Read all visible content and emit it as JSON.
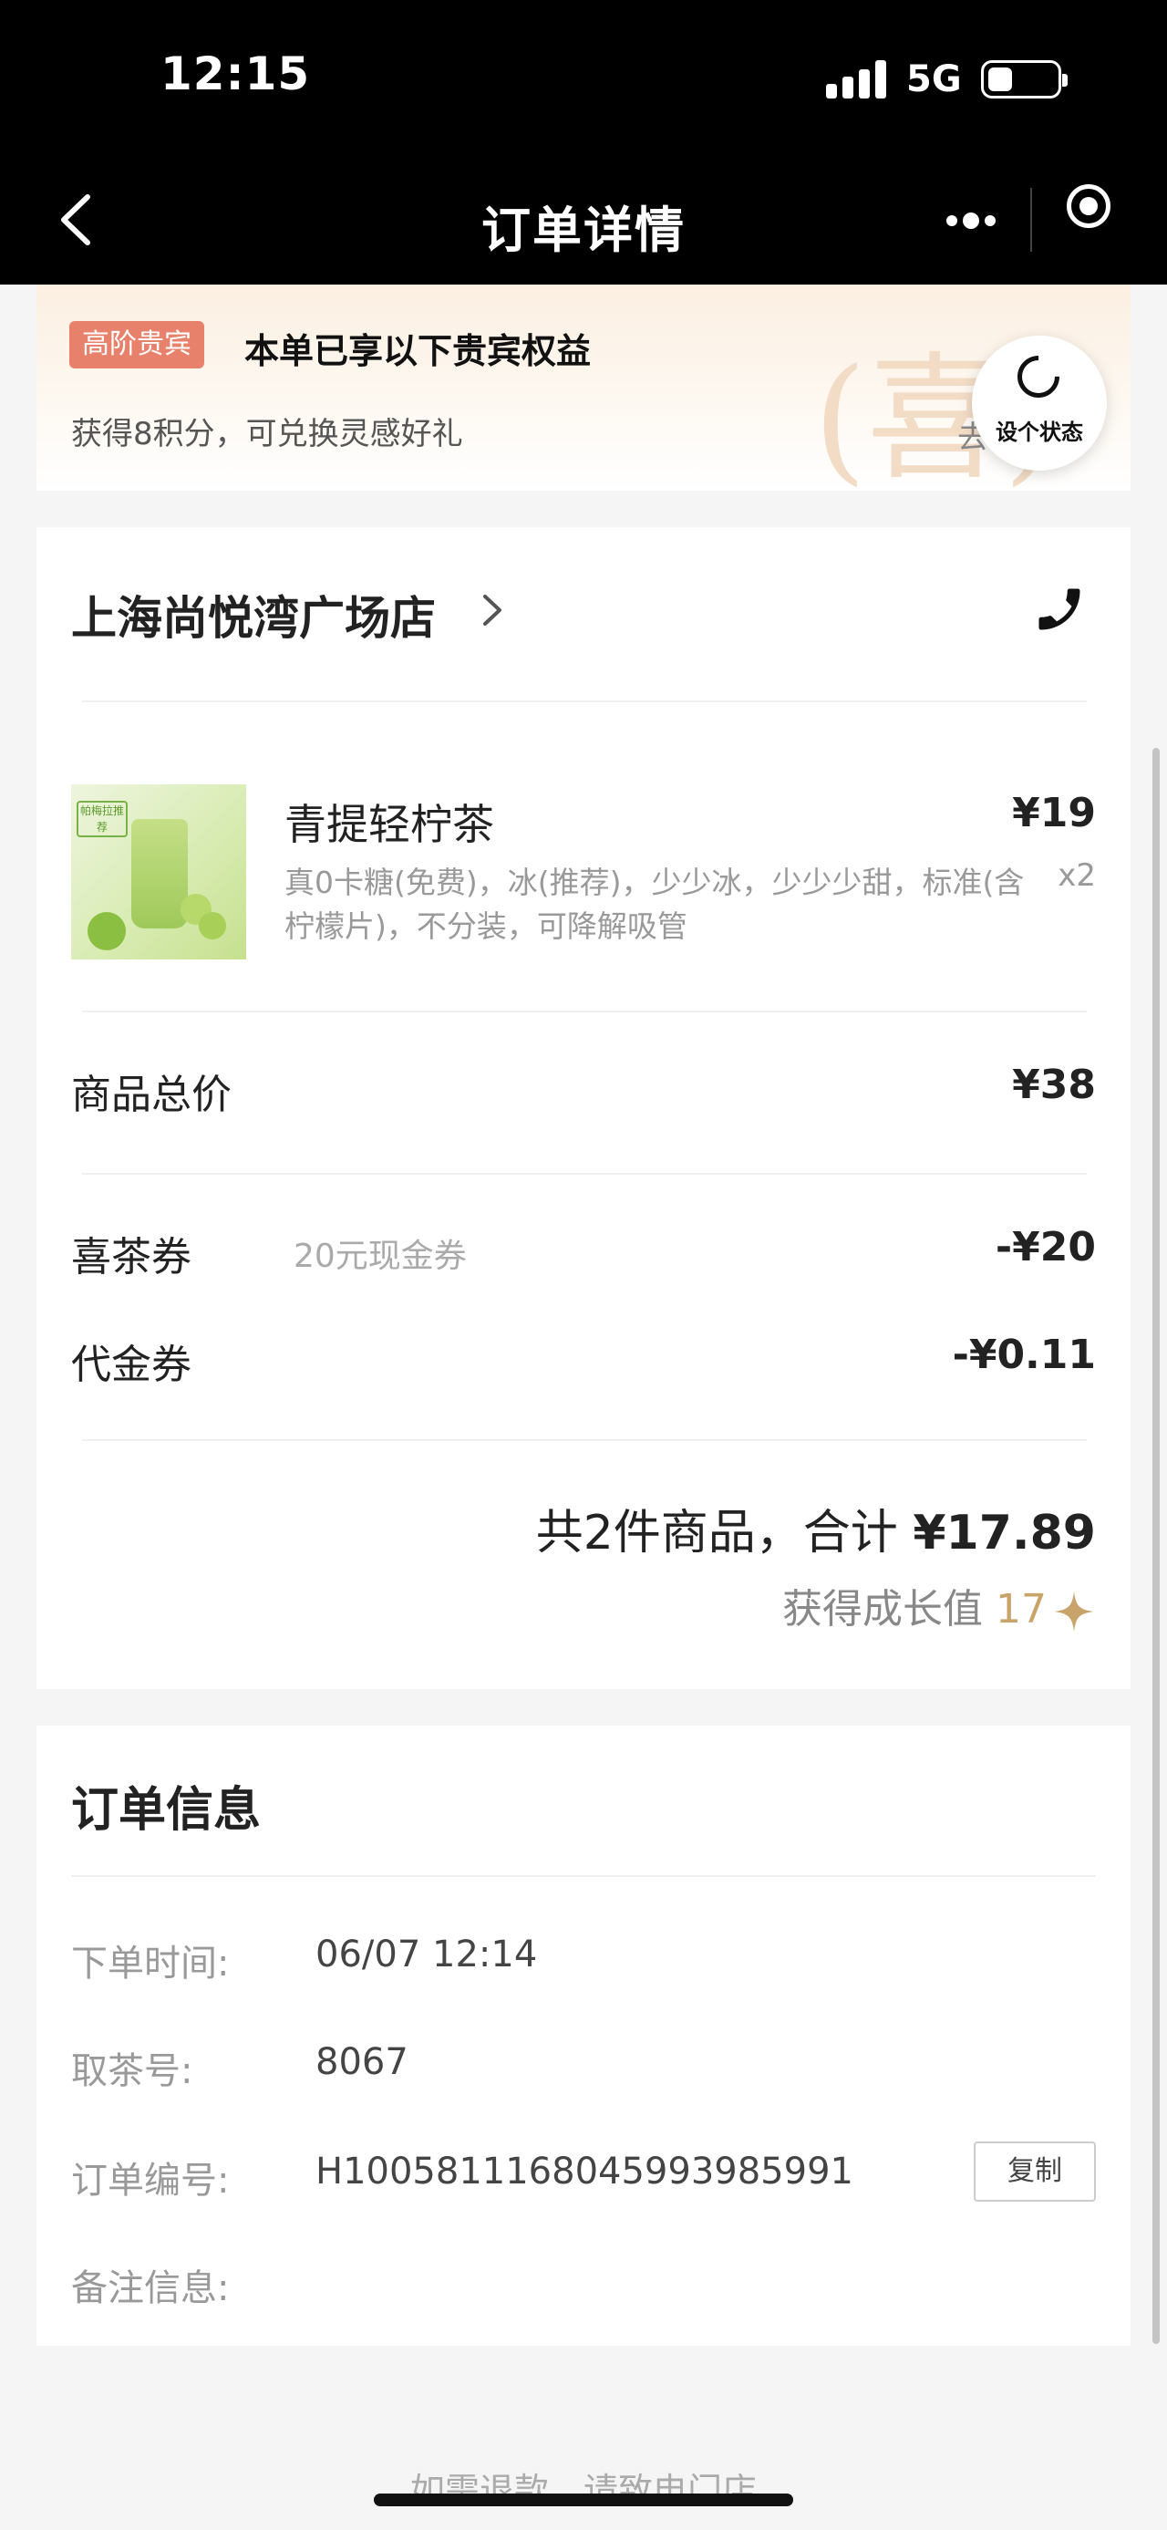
{
  "status_bar": {
    "time": "12:15",
    "network": "5G"
  },
  "nav": {
    "title": "订单详情"
  },
  "vip": {
    "badge": "高阶贵宾",
    "title": "本单已享以下贵宾权益",
    "subtitle": "获得8积分，可兑换灵感好礼",
    "watermark": "(喜)",
    "go_text": "去"
  },
  "floating_button": {
    "label": "设个状态"
  },
  "order": {
    "store_name": "上海尚悦湾广场店",
    "product": {
      "name": "青提轻柠茶",
      "options": "真0卡糖(免费)，冰(推荐)，少少冰，少少少甜，标准(含柠檬片)，不分装，可降解吸管",
      "price": "¥19",
      "quantity": "x2",
      "image_tag": "帕梅拉推荐"
    },
    "subtotal_label": "商品总价",
    "subtotal_value": "¥38",
    "coupon_label": "喜茶券",
    "coupon_desc": "20元现金券",
    "coupon_value": "-¥20",
    "voucher_label": "代金券",
    "voucher_value": "-¥0.11",
    "total_prefix": "共2件商品，合计",
    "total_amount": "¥17.89",
    "growth_label": "获得成长值",
    "growth_value": "17"
  },
  "order_info": {
    "title": "订单信息",
    "time_label": "下单时间:",
    "time_value": "06/07 12:14",
    "pickup_label": "取茶号:",
    "pickup_value": "8067",
    "order_no_label": "订单编号:",
    "order_no_value": "H1005811168045993985991",
    "copy_button": "复制",
    "remark_label": "备注信息:"
  },
  "footer": {
    "refund_note": "如需退款，请致电门店"
  },
  "colors": {
    "vip_badge": "#e8816b",
    "growth_accent": "#c9a46a"
  }
}
